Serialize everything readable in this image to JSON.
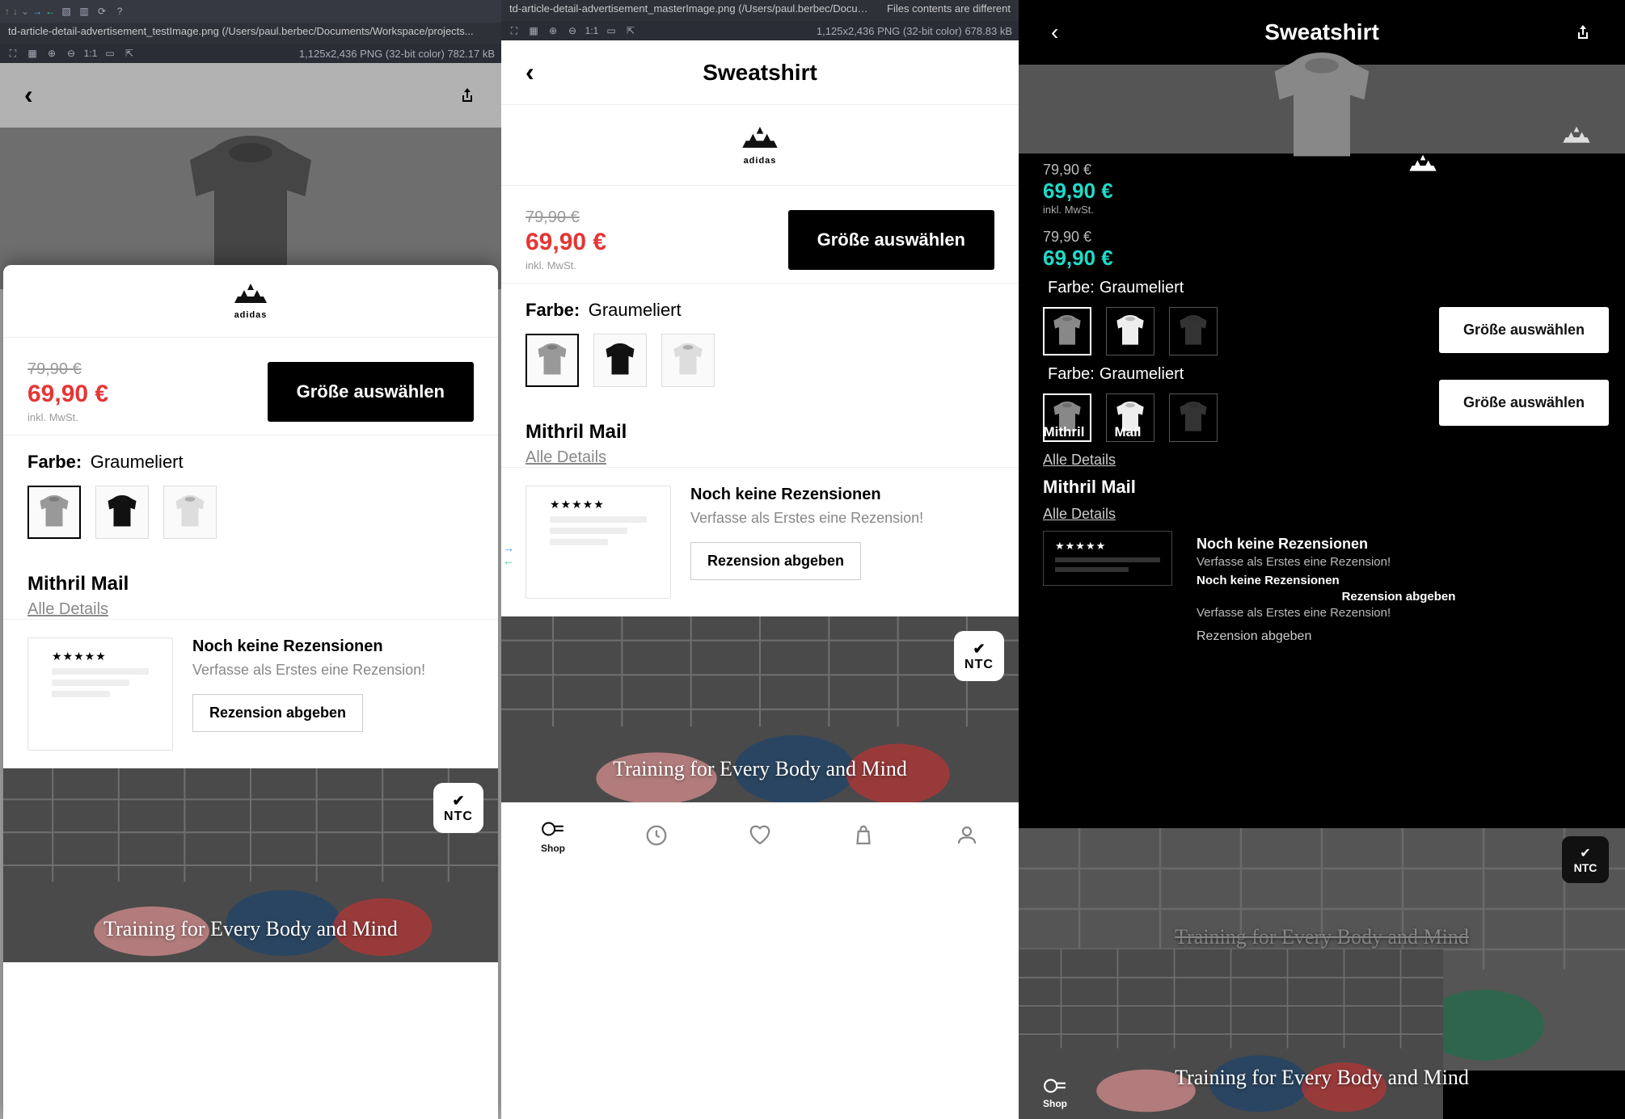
{
  "topRightBanner": "Files contents are different",
  "pane1": {
    "tab": "td-article-detail-advertisement_testImage.png (/Users/paul.berbec/Documents/Workspace/projects...",
    "imgInfo": "1,125x2,436 PNG (32-bit color) 782.17 kB",
    "zoom": "1:1",
    "header": {
      "back": "‹",
      "share": "⇪"
    },
    "brand": "adidas",
    "price": {
      "old": "79,90 €",
      "new": "69,90 €",
      "tax": "inkl. MwSt."
    },
    "sizeBtn": "Größe auswählen",
    "colorLabel": "Farbe:",
    "colorValue": "Graumeliert",
    "mithril": "Mithril Mail",
    "detailsLink": "Alle Details",
    "review": {
      "heading": "Noch keine Rezensionen",
      "sub": "Verfasse als Erstes eine Rezension!",
      "btn": "Rezension abgeben",
      "stars": "★★★★★"
    },
    "promo": {
      "caption": "Training for Every Body and Mind",
      "badge": "NTC"
    }
  },
  "pane2": {
    "tab": "td-article-detail-advertisement_masterImage.png (/Users/paul.berbec/Documents/Workspace/proje...",
    "imgInfo": "1,125x2,436 PNG (32-bit color) 678.83 kB",
    "zoom": "1:1",
    "title": "Sweatshirt",
    "brand": "adidas",
    "price": {
      "old": "79,90 €",
      "new": "69,90 €",
      "tax": "inkl. MwSt."
    },
    "sizeBtn": "Größe auswählen",
    "colorLabel": "Farbe:",
    "colorValue": "Graumeliert",
    "mithril": "Mithril Mail",
    "detailsLink": "Alle Details",
    "review": {
      "heading": "Noch keine Rezensionen",
      "sub": "Verfasse als Erstes eine Rezension!",
      "btn": "Rezension abgeben",
      "stars": "★★★★★"
    },
    "promo": {
      "caption": "Training for Every Body and Mind",
      "badge": "NTC"
    },
    "nav": {
      "shop": "Shop"
    }
  },
  "pane3": {
    "title": "Sweatshirt",
    "price1": {
      "old": "79,90 €",
      "new": "69,90 €",
      "tax": "inkl. MwSt."
    },
    "price2": {
      "old": "79,90 €",
      "new": "69,90 €"
    },
    "sizeBtn": "Größe auswählen",
    "colorLabel": "Farbe:",
    "colorValue": "Graumeliert",
    "mithril": "Mithril Mail",
    "detailsLink": "Alle Details",
    "stars": "★★★★★",
    "revH": "Noch keine Rezensionen",
    "revS": "Verfasse als Erstes eine Rezension!",
    "revH2": "Noch keine Rezensionen",
    "revIndent": "Rezension abgeben",
    "revS2": "Verfasse als Erstes eine Rezension!",
    "revBtn": "Rezension abgeben",
    "promoCap": "Training for Every Body and Mind",
    "promoCapGhost": "Training for Every Body and Mind",
    "badge": "NTC",
    "shop": "Shop"
  }
}
